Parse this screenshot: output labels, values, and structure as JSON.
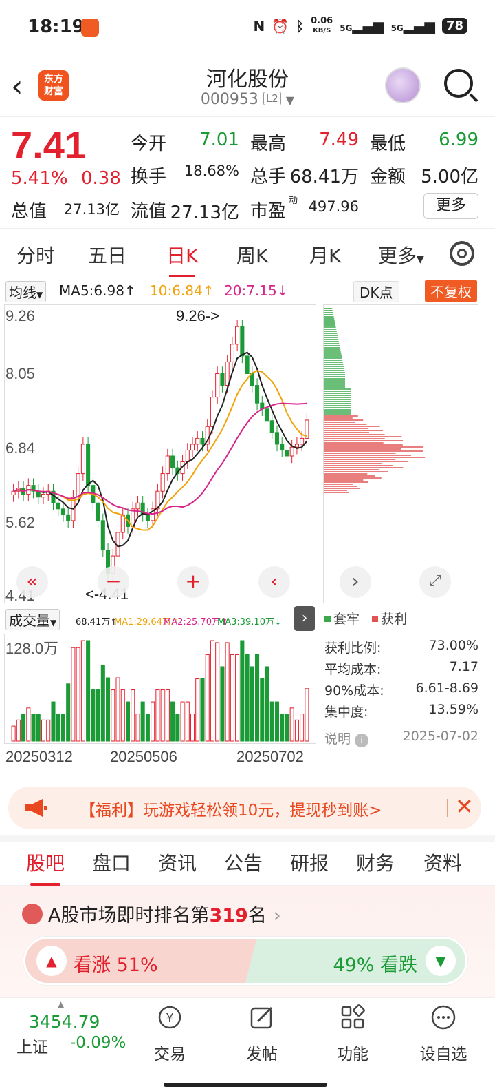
{
  "status": {
    "time": "18:19",
    "speed_top": "0.06",
    "speed_unit": "KB/S",
    "net1": "5G",
    "net2": "5G",
    "battery": "78"
  },
  "header": {
    "logo_line1": "东方",
    "logo_line2": "财富",
    "title": "河化股份",
    "code": "000953",
    "level": "L2"
  },
  "quote": {
    "price": "7.41",
    "pct": "5.41%",
    "change": "0.38",
    "fields": [
      {
        "label": "今开",
        "value": "7.01",
        "color": "green"
      },
      {
        "label": "最高",
        "value": "7.49",
        "color": "red"
      },
      {
        "label": "最低",
        "value": "6.99",
        "color": "green"
      },
      {
        "label": "换手",
        "value": "18.68%",
        "color": "black"
      },
      {
        "label": "总手",
        "value": "68.41万",
        "color": "black"
      },
      {
        "label": "金额",
        "value": "5.00亿",
        "color": "black"
      },
      {
        "label": "总值",
        "value": "27.13亿",
        "color": "black"
      },
      {
        "label": "流值",
        "value": "27.13亿",
        "color": "black"
      },
      {
        "label": "市盈",
        "value": "497.96",
        "color": "black"
      }
    ],
    "pe_sup": "动",
    "more": "更多"
  },
  "period_tabs": [
    "分时",
    "五日",
    "日K",
    "周K",
    "月K",
    "更多"
  ],
  "ma": {
    "selector": "均线",
    "ma5": "MA5:6.98↑",
    "ma10": "10:6.84↑",
    "ma20": "20:7.15↓",
    "colors": {
      "ma5": "#222222",
      "ma10": "#f0a30a",
      "ma20": "#d6248a"
    }
  },
  "dk_label": "DK点",
  "fq_label": "不复权",
  "kchart": {
    "y_labels": [
      "9.26",
      "8.05",
      "6.84",
      "5.62",
      "4.41"
    ],
    "high_note": "9.26->",
    "low_note": "<-4.41"
  },
  "volume": {
    "selector": "成交量",
    "vol": "68.41万↑",
    "ma1": "MA1:29.64万↑",
    "ma2": "MA2:25.70万↑",
    "ma3": "MA3:39.10万↓",
    "y_label": "128.0万",
    "dates": [
      "20250312",
      "20250506",
      "20250702"
    ]
  },
  "chip": {
    "legend_trap": "套牢",
    "legend_profit": "获利",
    "stats": [
      {
        "label": "获利比例:",
        "value": "73.00%"
      },
      {
        "label": "平均成本:",
        "value": "7.17"
      },
      {
        "label": "90%成本:",
        "value": "6.61-8.69"
      },
      {
        "label": "集中度:",
        "value": "13.59%"
      }
    ],
    "note_label": "说明",
    "date": "2025-07-02"
  },
  "promo": {
    "text": "【福利】玩游戏轻松领10元，提现秒到账>"
  },
  "bottom_tabs": [
    "股吧",
    "盘口",
    "资讯",
    "公告",
    "研报",
    "财务",
    "资料"
  ],
  "rank": {
    "prefix": "A股市场即时排名第",
    "number": "319",
    "suffix": "名"
  },
  "vote": {
    "up": "看涨 51%",
    "down": "49% 看跌",
    "up_fraction": 0.51
  },
  "bottom_nav": {
    "index_value": "3454.79",
    "index_name": "上证",
    "index_change": "-0.09%",
    "items": [
      "交易",
      "发帖",
      "功能",
      "设自选"
    ]
  },
  "chart_data": {
    "type": "candlestick",
    "y_range": [
      4.41,
      9.26
    ],
    "x_dates_shown": [
      "20250312",
      "20250506",
      "20250702"
    ],
    "close_approx": [
      6.2,
      6.25,
      6.15,
      6.3,
      6.2,
      6.1,
      6.15,
      6.2,
      6.0,
      5.9,
      5.8,
      5.7,
      6.1,
      6.5,
      7.0,
      6.3,
      6.0,
      5.7,
      5.2,
      4.8,
      5.1,
      5.5,
      5.8,
      5.6,
      5.9,
      6.0,
      5.8,
      5.7,
      5.9,
      6.2,
      6.5,
      6.8,
      6.6,
      6.5,
      6.7,
      6.9,
      7.0,
      7.1,
      7.0,
      7.3,
      7.8,
      8.2,
      8.0,
      8.4,
      8.7,
      9.0,
      8.5,
      8.2,
      8.0,
      7.7,
      7.6,
      7.4,
      7.2,
      7.0,
      6.9,
      6.8,
      6.95,
      7.0,
      7.1,
      7.41
    ],
    "volume_max_label": "128.0万"
  }
}
